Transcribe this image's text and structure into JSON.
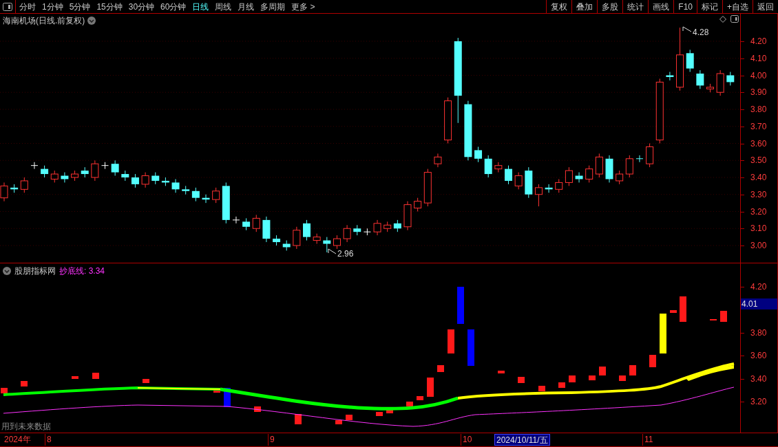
{
  "toolbar": {
    "periods": [
      {
        "label": "分时",
        "selected": false
      },
      {
        "label": "1分钟",
        "selected": false
      },
      {
        "label": "5分钟",
        "selected": false
      },
      {
        "label": "15分钟",
        "selected": false
      },
      {
        "label": "30分钟",
        "selected": false
      },
      {
        "label": "60分钟",
        "selected": false
      },
      {
        "label": "日线",
        "selected": true
      },
      {
        "label": "周线",
        "selected": false
      },
      {
        "label": "月线",
        "selected": false
      },
      {
        "label": "多周期",
        "selected": false
      }
    ],
    "more": {
      "label": "更多",
      "arrow": ">"
    },
    "buttons": [
      "复权",
      "叠加",
      "多股",
      "统计",
      "画线",
      "F10",
      "标记",
      "+自选",
      "返回"
    ]
  },
  "main_chart": {
    "title": "海南机场(日线.前复权)",
    "high_marker": "4.28",
    "low_marker": "2.96",
    "axis_ticks": [
      "4.20",
      "4.10",
      "4.00",
      "3.90",
      "3.80",
      "3.70",
      "3.60",
      "3.50",
      "3.40",
      "3.30",
      "3.20",
      "3.10",
      "3.00"
    ]
  },
  "indicator": {
    "title": "股朋指标网",
    "line_label": "抄底线:",
    "line_value": "3.34",
    "axis_ticks": [
      "4.20",
      "3.80",
      "3.60",
      "3.40",
      "3.20"
    ],
    "current_value": "4.01",
    "note": "用到未来数据"
  },
  "date_axis": [
    {
      "label": "2024年",
      "kind": "year"
    },
    {
      "label": "8",
      "kind": "month"
    },
    {
      "label": "9",
      "kind": "month"
    },
    {
      "label": "10",
      "kind": "month"
    },
    {
      "label": "2024/10/11/五",
      "kind": "cursor"
    },
    {
      "label": "11",
      "kind": "month"
    }
  ]
}
